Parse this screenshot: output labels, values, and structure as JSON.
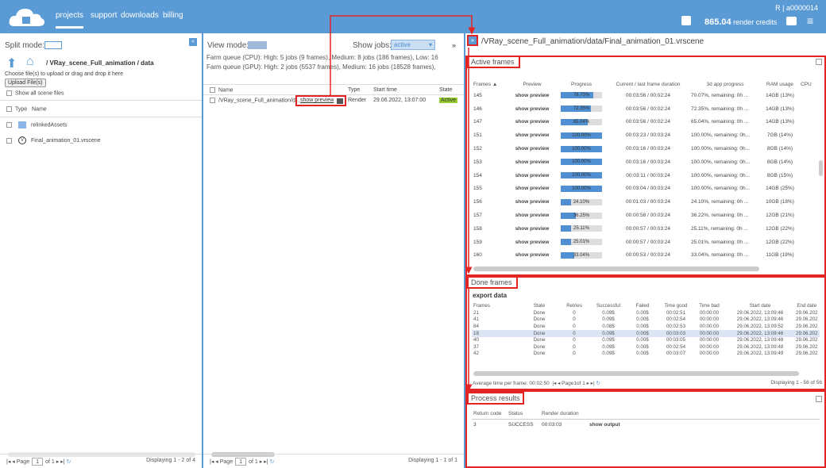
{
  "nav": {
    "projects": "projects",
    "support": "support",
    "downloads": "downloads",
    "billing": "billing"
  },
  "user": "R | a0000014",
  "credits": {
    "amount": "865.04",
    "label": "render credits"
  },
  "left": {
    "split_mode": "Split mode:",
    "path": "/ VRay_scene_Full_animation / data",
    "hint": "Choose file(s) to upload or drag and drop it here",
    "upload": "Upload File(s)",
    "show_all": "Show all scene files",
    "col_type": "Type",
    "col_name": "Name",
    "files": [
      "relinkedAssets",
      "Final_animation_01.vrscene"
    ],
    "pager": {
      "page": "Page",
      "page_num": "1",
      "of": "of 1",
      "display": "Displaying 1 - 2 of 4"
    }
  },
  "mid": {
    "view_mode": "View mode:",
    "show_jobs": "Show jobs:",
    "show_jobs_value": "active",
    "cpu_queue": "Farm queue (CPU): High: 5 jobs (9 frames), Medium: 8 jobs (186 frames), Low: 16",
    "gpu_queue": "Farm queue (GPU): High: 2 jobs (5537 frames), Medium: 16 jobs (18528 frames),",
    "cols": {
      "name": "Name",
      "type": "Type",
      "start": "Start time",
      "state": "State"
    },
    "job": {
      "name": "/VRay_scene_Full_animation/d...",
      "preview": "show preview",
      "type": "Render",
      "start": "29.06.2022, 13:07:00",
      "state": "Active"
    },
    "pager": {
      "page": "Page",
      "page_num": "1",
      "of": "of 1",
      "display": "Displaying 1 - 1 of 1"
    }
  },
  "right": {
    "path": "/VRay_scene_Full_animation/data/Final_animation_01.vrscene",
    "expand": "»",
    "active_title": "Active frames",
    "active_cols": [
      "Frames ▲",
      "Preview",
      "Progress",
      "Current / last frame duration",
      "3d app progress",
      "RAM usage",
      "CPU"
    ],
    "active_rows": [
      [
        "145",
        "show preview",
        "78.75%",
        "00:03:56 / 00:02:24",
        "70.07%, remaining: 0h ...",
        "14GB (13%)"
      ],
      [
        "146",
        "show preview",
        "72.35%",
        "00:03:56 / 00:02:24",
        "72.35%, remaining: 0h ...",
        "14GB (13%)"
      ],
      [
        "147",
        "show preview",
        "65.04%",
        "00:03:56 / 00:02:24",
        "65.04%, remaining: 0h ...",
        "14GB (13%)"
      ],
      [
        "151",
        "show preview",
        "100.00%",
        "00:03:23 / 00:03:24",
        "100.00%, remaining: 0h...",
        "7GB (14%)"
      ],
      [
        "152",
        "show preview",
        "100.00%",
        "00:03:16 / 00:03:24",
        "100.00%, remaining: 0h...",
        "8GB (14%)"
      ],
      [
        "153",
        "show preview",
        "100.00%",
        "00:03:16 / 00:03:24",
        "100.00%, remaining: 0h...",
        "8GB (14%)"
      ],
      [
        "154",
        "show preview",
        "100.00%",
        "00:03:11 / 00:03:24",
        "100.00%, remaining: 0h...",
        "8GB (15%)"
      ],
      [
        "155",
        "show preview",
        "100.00%",
        "00:03:04 / 00:03:24",
        "100.00%, remaining: 0h...",
        "14GB (25%)"
      ],
      [
        "156",
        "show preview",
        "24.10%",
        "00:01:03 / 00:03:24",
        "24.10%, remaining: 0h ...",
        "10GB (18%)"
      ],
      [
        "157",
        "show preview",
        "36.25%",
        "00:00:58 / 00:03:24",
        "36.22%, remaining: 0h ...",
        "12GB (21%)"
      ],
      [
        "158",
        "show preview",
        "25.11%",
        "00:00:57 / 00:03:24",
        "25.11%, remaining: 0h ...",
        "12GB (22%)"
      ],
      [
        "159",
        "show preview",
        "25.01%",
        "00:00:57 / 00:03:24",
        "25.01%, remaining: 0h ...",
        "12GB (22%)"
      ],
      [
        "160",
        "show preview",
        "33.04%",
        "00:00:53 / 00:03:24",
        "33.04%, remaining: 0h ...",
        "11GB (19%)"
      ]
    ],
    "done_title": "Done frames",
    "export": "export data",
    "done_cols": [
      "Frames",
      "State",
      "Retries",
      "Successful",
      "Failed",
      "Time good",
      "Time bad",
      "Start date",
      "End date"
    ],
    "done_rows": [
      [
        "21",
        "Done",
        "0",
        "0.09$",
        "0.00$",
        "00:02:51",
        "00:00:00",
        "29.06.2022, 13:09:46",
        "29.06.202"
      ],
      [
        "41",
        "Done",
        "0",
        "0.09$",
        "0.00$",
        "00:02:54",
        "00:00:00",
        "29.06.2022, 13:09:46",
        "29.06.202"
      ],
      [
        "84",
        "Done",
        "0",
        "0.08$",
        "0.00$",
        "00:02:53",
        "00:00:00",
        "29.06.2022, 13:09:52",
        "29.06.202"
      ],
      [
        "18",
        "Done",
        "0",
        "0.09$",
        "0.00$",
        "00:03:03",
        "00:00:00",
        "29.06.2022, 13:09:46",
        "29.06.202"
      ],
      [
        "40",
        "Done",
        "0",
        "0.09$",
        "0.00$",
        "00:03:05",
        "00:00:00",
        "29.06.2022, 13:09:48",
        "29.06.202"
      ],
      [
        "37",
        "Done",
        "0",
        "0.09$",
        "0.00$",
        "00:02:54",
        "00:00:00",
        "29.06.2022, 13:09:48",
        "29.06.202"
      ],
      [
        "42",
        "Done",
        "0",
        "0.09$",
        "0.00$",
        "00:03:07",
        "00:00:00",
        "29.06.2022, 13:09:49",
        "29.06.202"
      ]
    ],
    "avg": "Average time per frame: 00:02:50",
    "done_pager": {
      "page": "Page",
      "page_num": "1",
      "of": "of 1",
      "display": "Displaying 1 - 56 of 56"
    },
    "process_title": "Process results",
    "proc_cols": [
      "Return code",
      "Status",
      "Render duration"
    ],
    "proc_row": [
      "3",
      "SUCCESS",
      "00:03:03",
      "show output"
    ]
  },
  "colors": {
    "brand": "#5b9bd5",
    "annotation": "#e32424",
    "progress": "#4f8fd2"
  }
}
